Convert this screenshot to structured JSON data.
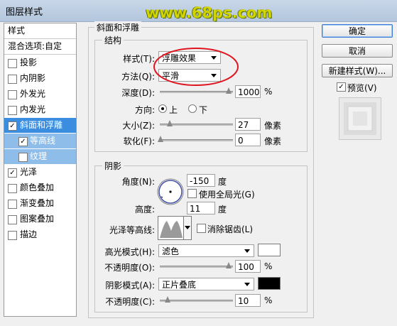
{
  "window": {
    "title": "图层样式",
    "watermark": "www.68ps.com"
  },
  "left_panel": {
    "header": "样式",
    "blend_options": "混合选项:自定",
    "items": [
      {
        "label": "投影",
        "checked": false
      },
      {
        "label": "内阴影",
        "checked": false
      },
      {
        "label": "外发光",
        "checked": false
      },
      {
        "label": "内发光",
        "checked": false
      },
      {
        "label": "斜面和浮雕",
        "checked": true
      },
      {
        "label": "等高线",
        "checked": true
      },
      {
        "label": "纹理",
        "checked": false
      },
      {
        "label": "光泽",
        "checked": true
      },
      {
        "label": "颜色叠加",
        "checked": false
      },
      {
        "label": "渐变叠加",
        "checked": false
      },
      {
        "label": "图案叠加",
        "checked": false
      },
      {
        "label": "描边",
        "checked": false
      }
    ]
  },
  "bevel": {
    "title": "斜面和浮雕",
    "structure_title": "结构",
    "style_label": "样式(T):",
    "style_value": "浮雕效果",
    "technique_label": "方法(Q):",
    "technique_value": "平滑",
    "depth_label": "深度(D):",
    "depth_value": "1000",
    "depth_unit": "%",
    "direction_label": "方向:",
    "dir_up": "上",
    "dir_down": "下",
    "size_label": "大小(Z):",
    "size_value": "27",
    "size_unit": "像素",
    "soften_label": "软化(F):",
    "soften_value": "0",
    "soften_unit": "像素"
  },
  "shading": {
    "title": "阴影",
    "angle_label": "角度(N):",
    "angle_value": "-150",
    "angle_unit": "度",
    "global_light": "使用全局光(G)",
    "altitude_label": "高度:",
    "altitude_value": "11",
    "altitude_unit": "度",
    "gloss_contour_label": "光泽等高线:",
    "anti_alias": "消除锯齿(L)",
    "highlight_mode_label": "高光模式(H):",
    "highlight_mode_value": "滤色",
    "highlight_opacity_label": "不透明度(O):",
    "highlight_opacity_value": "100",
    "highlight_opacity_unit": "%",
    "shadow_mode_label": "阴影模式(A):",
    "shadow_mode_value": "正片叠底",
    "shadow_opacity_label": "不透明度(C):",
    "shadow_opacity_value": "10",
    "shadow_opacity_unit": "%"
  },
  "right": {
    "ok": "确定",
    "cancel": "取消",
    "new_style": "新建样式(W)...",
    "preview": "预览(V)"
  },
  "colors": {
    "highlight": "#ffffff",
    "shadow": "#000000",
    "selected": "#3b8de0",
    "annotation": "#e0141e"
  }
}
